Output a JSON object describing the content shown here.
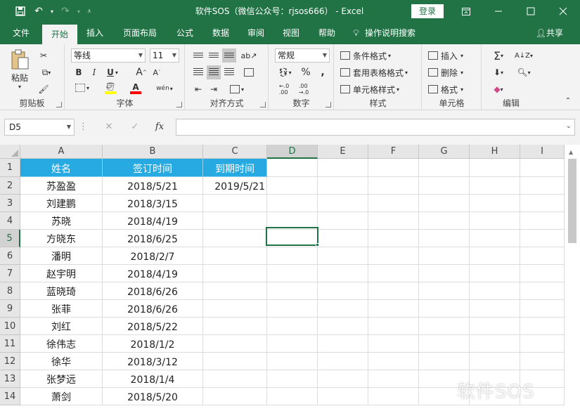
{
  "window": {
    "title": "软件SOS（微信公众号：rjsos666） - Excel",
    "login_label": "登录",
    "controls": [
      "ribbon-display-icon",
      "minimize-icon",
      "maximize-icon",
      "close-icon"
    ]
  },
  "qat": {
    "save_icon": "save-icon",
    "undo_icon": "undo-icon",
    "redo_icon": "redo-icon",
    "customize_icon": "customize-icon"
  },
  "tabs": [
    "文件",
    "开始",
    "插入",
    "页面布局",
    "公式",
    "数据",
    "审阅",
    "视图",
    "帮助"
  ],
  "active_tab": "开始",
  "tell_me": "操作说明搜索",
  "share": "共享",
  "ribbon": {
    "clipboard": {
      "label": "剪贴板",
      "paste": "粘贴"
    },
    "font": {
      "label": "字体",
      "font_name": "等线",
      "font_size": "11",
      "bold": "B",
      "italic": "I",
      "underline": "U",
      "grow": "A",
      "shrink": "A",
      "phonetic": "wén"
    },
    "alignment": {
      "label": "对齐方式"
    },
    "number": {
      "label": "数字",
      "format": "常规",
      "percent": "%"
    },
    "styles": {
      "label": "样式",
      "conditional": "条件格式",
      "table": "套用表格格式",
      "cell": "单元格样式"
    },
    "cells": {
      "label": "单元格",
      "insert": "插入",
      "delete": "删除",
      "format": "格式"
    },
    "editing": {
      "label": "编辑"
    }
  },
  "formula_bar": {
    "name_box": "D5",
    "fx": "fx",
    "formula": ""
  },
  "columns": [
    "A",
    "B",
    "C",
    "D",
    "E",
    "F",
    "G",
    "H",
    "I"
  ],
  "selected_column": "D",
  "selected_row": "5",
  "rows": [
    "1",
    "2",
    "3",
    "4",
    "5",
    "6",
    "7",
    "8",
    "9",
    "10",
    "11",
    "12",
    "13",
    "14"
  ],
  "header_row": {
    "a": "姓名",
    "b": "签订时间",
    "c": "到期时间"
  },
  "data_rows": [
    {
      "a": "苏盈盈",
      "b": "2018/5/21",
      "c": "2019/5/21"
    },
    {
      "a": "刘建鹏",
      "b": "2018/3/15",
      "c": ""
    },
    {
      "a": "苏晓",
      "b": "2018/4/19",
      "c": ""
    },
    {
      "a": "方晓东",
      "b": "2018/6/25",
      "c": ""
    },
    {
      "a": "潘明",
      "b": "2018/2/7",
      "c": ""
    },
    {
      "a": "赵宇明",
      "b": "2018/4/19",
      "c": ""
    },
    {
      "a": "蓝晓琦",
      "b": "2018/6/26",
      "c": ""
    },
    {
      "a": "张菲",
      "b": "2018/6/26",
      "c": ""
    },
    {
      "a": "刘红",
      "b": "2018/5/22",
      "c": ""
    },
    {
      "a": "徐伟志",
      "b": "2018/1/2",
      "c": ""
    },
    {
      "a": "徐华",
      "b": "2018/3/12",
      "c": ""
    },
    {
      "a": "张梦远",
      "b": "2018/1/4",
      "c": ""
    },
    {
      "a": "萧剑",
      "b": "2018/5/20",
      "c": ""
    }
  ],
  "watermark": "软件SOS",
  "colors": {
    "excel_green": "#217346",
    "header_fill": "#27a9e1"
  }
}
